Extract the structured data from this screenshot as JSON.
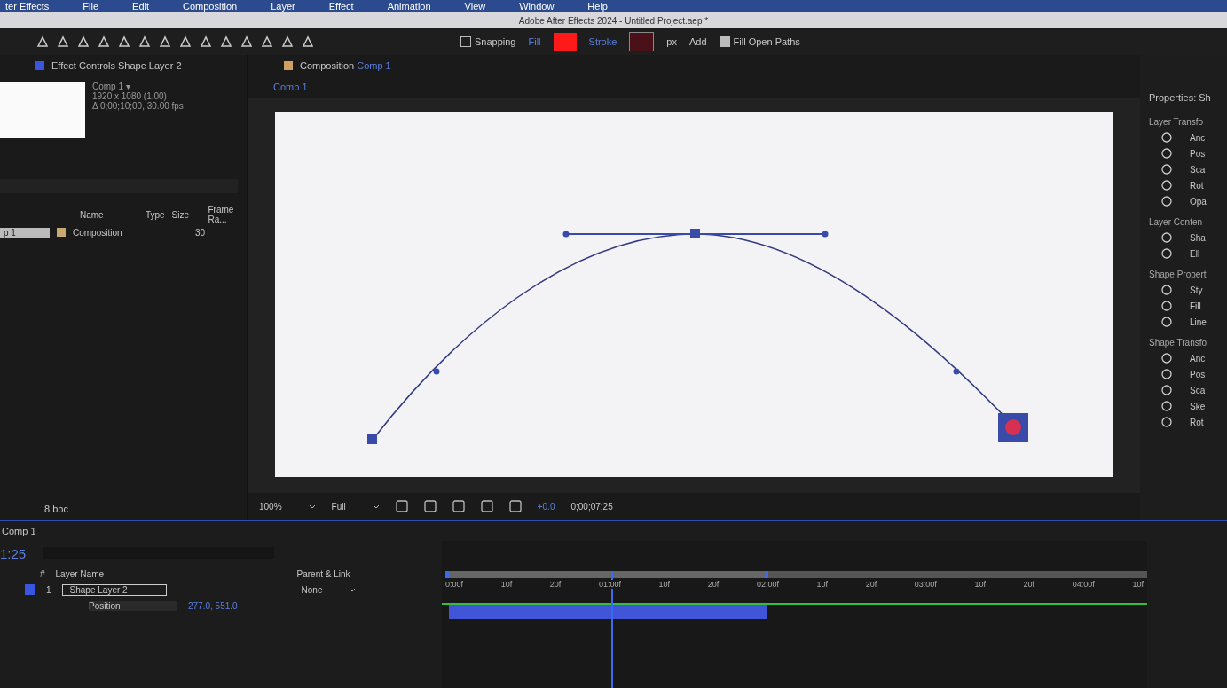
{
  "menu_bar": {
    "items": [
      "ter Effects",
      "File",
      "Edit",
      "Composition",
      "Layer",
      "Effect",
      "Animation",
      "View",
      "Window",
      "Help"
    ]
  },
  "window": {
    "title": "Adobe After Effects 2024 - Untitled Project.aep *"
  },
  "toolbar": {
    "snapping": {
      "label": "Snapping",
      "checked": false
    },
    "fill": {
      "label": "Fill",
      "color": "#ff1a1a"
    },
    "stroke": {
      "label": "Stroke",
      "color": "#4a1118"
    },
    "stroke_width": "px",
    "add": "Add",
    "option": {
      "label": "Fill Open Paths",
      "checked": true
    }
  },
  "project_panel": {
    "tab": "Effect Controls Shape Layer 2",
    "info": [
      "Comp 1 ▾",
      "1920 x 1080 (1.00)",
      "Δ 0;00;10;00, 30.00 fps"
    ],
    "columns": [
      "Name",
      "Type",
      "Size",
      "Frame Ra..."
    ],
    "rows": [
      {
        "name": "p 1",
        "type": "Composition",
        "frame_rate": "30",
        "selected": true
      }
    ],
    "footer": "8 bpc"
  },
  "composition_panel": {
    "tab": "Composition",
    "comp_name": "Comp 1",
    "breadcrumb": "Comp 1",
    "zoom": "100%",
    "resolution": "Full",
    "exposure": "+0.0",
    "timecode": "0;00;07;25"
  },
  "properties_panel": {
    "title": "Properties: Sh",
    "sections": [
      {
        "title": "Layer Transfo",
        "items": [
          "Anc",
          "Pos",
          "Sca",
          "Rot",
          "Opa"
        ]
      },
      {
        "title": "Layer Conten",
        "items": [
          "Sha",
          "Ell"
        ]
      },
      {
        "title": "Shape Propert",
        "items": [
          "Sty",
          "Fill",
          "Line"
        ]
      },
      {
        "title": "Shape Transfo",
        "items": [
          "Anc",
          "Pos",
          "Sca",
          "Ske",
          "Rot"
        ]
      }
    ]
  },
  "timeline": {
    "tab": "Comp 1",
    "timecode": "1:25",
    "columns": [
      "#",
      "Layer Name",
      "Parent & Link"
    ],
    "layers": [
      {
        "number": "1",
        "name": "Shape Layer 2",
        "color": "#3a55e0",
        "parent": "None",
        "property": "Position",
        "value": "277.0, 551.0"
      }
    ],
    "ruler": [
      "0:00f",
      "10f",
      "20f",
      "01:00f",
      "10f",
      "20f",
      "02:00f",
      "10f",
      "20f",
      "03:00f",
      "10f",
      "20f",
      "04:00f",
      "10f"
    ],
    "playhead": {
      "level": 0.24
    },
    "work_area": {
      "level": 0.45
    }
  }
}
